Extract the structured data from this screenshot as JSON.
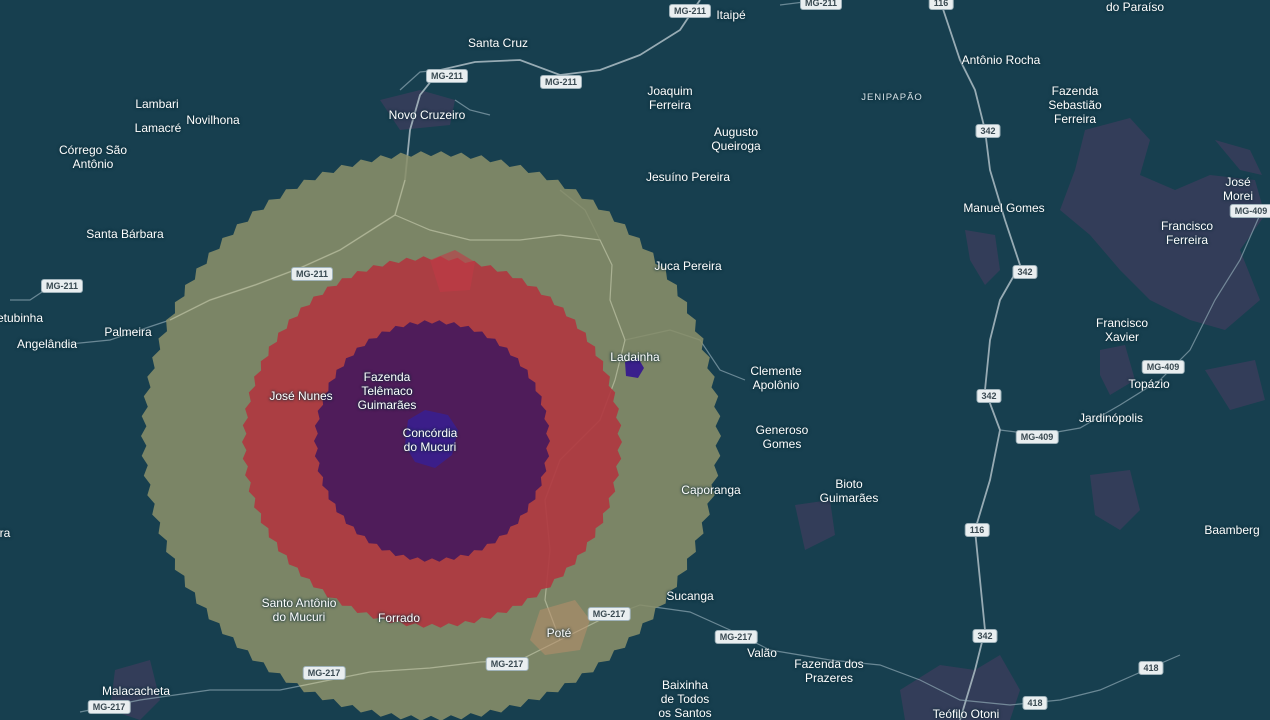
{
  "map": {
    "colors": {
      "background": "#173f4f",
      "ring_outer": "#8a8f6a",
      "ring_middle": "#b0363f",
      "ring_inner": "#4a1a5c",
      "core": "#3a1f8c",
      "urban": "#3d3e5c",
      "road": "#8fa8b4",
      "highway": "#aebec6"
    },
    "overlay_rings": [
      "outer",
      "middle",
      "inner",
      "core"
    ],
    "places": [
      {
        "id": "itaipe",
        "name": "Itaipé"
      },
      {
        "id": "do-paraiso",
        "name": "do Paraíso"
      },
      {
        "id": "santa-cruz",
        "name": "Santa Cruz"
      },
      {
        "id": "antonio-rocha",
        "name": "Antônio Rocha"
      },
      {
        "id": "joaquim-ferreira",
        "name": "Joaquim\nFerreira"
      },
      {
        "id": "jenipapao",
        "name": "JENIPAPÃO",
        "district": true
      },
      {
        "id": "fazenda-sebastiao-ferreira",
        "name": "Fazenda\nSebastião\nFerreira"
      },
      {
        "id": "lambari",
        "name": "Lambari"
      },
      {
        "id": "novo-cruzeiro",
        "name": "Novo Cruzeiro"
      },
      {
        "id": "novilhona",
        "name": "Novilhona"
      },
      {
        "id": "lamacre",
        "name": "Lamacré"
      },
      {
        "id": "augusto-queiroga",
        "name": "Augusto\nQueiroga"
      },
      {
        "id": "corrego-sao-antonio",
        "name": "Córrego São\nAntônio"
      },
      {
        "id": "jesuino-pereira",
        "name": "Jesuíno Pereira"
      },
      {
        "id": "jose-moreira",
        "name": "José Morei"
      },
      {
        "id": "manuel-gomes",
        "name": "Manuel Gomes"
      },
      {
        "id": "francisco-ferreira",
        "name": "Francisco\nFerreira"
      },
      {
        "id": "santa-barbara",
        "name": "Santa Bárbara"
      },
      {
        "id": "juca-pereira",
        "name": "Juca Pereira"
      },
      {
        "id": "etubinha",
        "name": "etubinha"
      },
      {
        "id": "palmeira",
        "name": "Palmeira"
      },
      {
        "id": "francisco-xavier",
        "name": "Francisco\nXavier"
      },
      {
        "id": "angelandia",
        "name": "Angelândia"
      },
      {
        "id": "ladainha",
        "name": "Ladainha"
      },
      {
        "id": "clemente-apolonio",
        "name": "Clemente\nApolônio"
      },
      {
        "id": "topazio",
        "name": "Topázio"
      },
      {
        "id": "fazenda-telemaco-guimaraes",
        "name": "Fazenda\nTelêmaco\nGuimarães"
      },
      {
        "id": "jose-nunes",
        "name": "José Nunes"
      },
      {
        "id": "jardinopolis",
        "name": "Jardinópolis"
      },
      {
        "id": "concordia-do-mucuri",
        "name": "Concórdia\ndo Mucuri"
      },
      {
        "id": "generoso-gomes",
        "name": "Generoso\nGomes"
      },
      {
        "id": "bioto-guimaraes",
        "name": "Bioto\nGuimarães"
      },
      {
        "id": "caporanga",
        "name": "Caporanga"
      },
      {
        "id": "ra",
        "name": "ra"
      },
      {
        "id": "baamberg",
        "name": "Baamberg"
      },
      {
        "id": "sucanga",
        "name": "Sucanga"
      },
      {
        "id": "santo-antonio-do-mucuri",
        "name": "Santo Antônio\ndo Mucuri"
      },
      {
        "id": "forrado",
        "name": "Forrado"
      },
      {
        "id": "pote",
        "name": "Poté"
      },
      {
        "id": "valao",
        "name": "Valão"
      },
      {
        "id": "fazenda-dos-prazeres",
        "name": "Fazenda dos\nPrazeres"
      },
      {
        "id": "malacacheta",
        "name": "Malacacheta"
      },
      {
        "id": "baixinha-de-todos-os-santos",
        "name": "Baixinha\nde Todos\nos Santos"
      },
      {
        "id": "teofilo-otoni",
        "name": "Teófilo Otoni"
      }
    ],
    "shields": [
      {
        "id": "mg211-a",
        "label": "MG-211"
      },
      {
        "id": "mg211-b",
        "label": "MG-211"
      },
      {
        "id": "mg211-c",
        "label": "MG-211"
      },
      {
        "id": "mg211-d",
        "label": "MG-211"
      },
      {
        "id": "mg211-e",
        "label": "MG-211"
      },
      {
        "id": "mg211-f",
        "label": "MG-211"
      },
      {
        "id": "br116-a",
        "label": "116"
      },
      {
        "id": "br116-b",
        "label": "116"
      },
      {
        "id": "br342-a",
        "label": "342"
      },
      {
        "id": "br342-b",
        "label": "342"
      },
      {
        "id": "br342-c",
        "label": "342"
      },
      {
        "id": "br342-d",
        "label": "342"
      },
      {
        "id": "mg409-a",
        "label": "MG-409"
      },
      {
        "id": "mg409-b",
        "label": "MG-409"
      },
      {
        "id": "mg409-c",
        "label": "MG-409"
      },
      {
        "id": "mg217-a",
        "label": "MG-217"
      },
      {
        "id": "mg217-b",
        "label": "MG-217"
      },
      {
        "id": "mg217-c",
        "label": "MG-217"
      },
      {
        "id": "mg217-d",
        "label": "MG-217"
      },
      {
        "id": "mg217-e",
        "label": "MG-217"
      },
      {
        "id": "r418-a",
        "label": "418"
      },
      {
        "id": "r418-b",
        "label": "418"
      }
    ]
  }
}
